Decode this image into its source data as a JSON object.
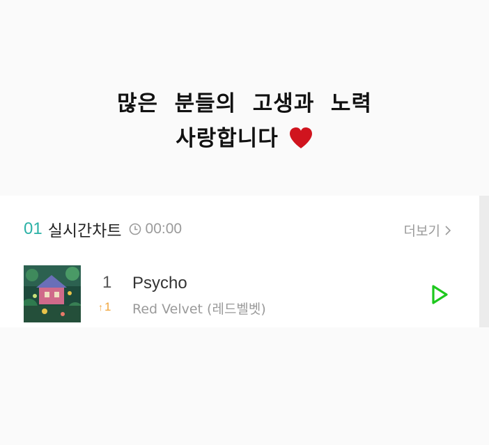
{
  "caption": {
    "line1": "많은  분들의  고생과  노력",
    "line2": "사랑합니다"
  },
  "chart": {
    "rank_number": "01",
    "title": "실시간차트",
    "clock_icon": "clock-icon",
    "time": "00:00",
    "more_label": "더보기",
    "more_icon": "chevron-right-icon"
  },
  "songs": [
    {
      "rank": "1",
      "change": "1",
      "change_icon": "up-arrow-icon",
      "title": "Psycho",
      "artist": "Red Velvet (레드벨벳)",
      "play_icon": "play-icon"
    }
  ],
  "colors": {
    "accent": "#2bb1a6",
    "play_green": "#1ec81e",
    "rank_up": "#f0a43a",
    "heart": "#d0141e"
  }
}
